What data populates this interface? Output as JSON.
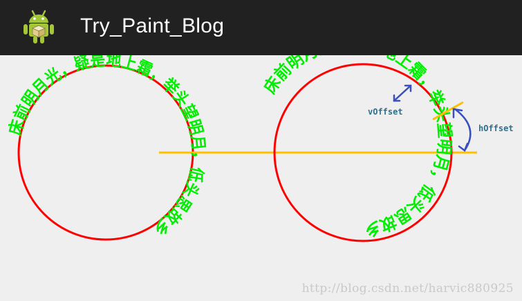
{
  "app": {
    "title": "Try_Paint_Blog",
    "icon": "android-robot-icon"
  },
  "canvas": {
    "left_drawing": {
      "path_text": "床前明月光，疑是地上霜，举头望明月，低头思故乡",
      "circle_color": "#ff0000",
      "text_color": "#00ee00",
      "baseline_color": "#ffc000"
    },
    "right_drawing": {
      "path_text": "床前明月光，疑是地上霜，举头望明月，低头思故乡",
      "circle_color": "#ff0000",
      "text_color": "#00ee00",
      "baseline_color": "#ffc000",
      "annotations": {
        "voffset_label": "vOffset",
        "hoffset_label": "hOffset",
        "arrow_color": "#3a4fbf"
      }
    }
  },
  "watermark": "http://blog.csdn.net/harvic880925"
}
